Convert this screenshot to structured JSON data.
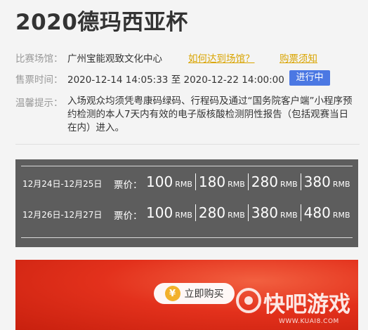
{
  "event": {
    "title": "2020德玛西亚杯"
  },
  "venue": {
    "label": "比赛场馆：",
    "name": "广州宝能观致文化中心",
    "directions_link": "如何达到场馆？",
    "ticket_notice_link": "购票须知"
  },
  "sale": {
    "label": "售票时间：",
    "start": "2020-12-14 14:05:33",
    "to": "至",
    "end": "2020-12-22 14:00:00",
    "status": "进行中"
  },
  "notice": {
    "label": "温馨提示：",
    "text": "入场观众均须凭粤康码绿码、行程码及通过“国务院客户端”小程序预约检测的本人7天内有效的电子版核酸检测阴性报告（包括观赛当日在内）进入。"
  },
  "prices": {
    "price_label": "票价：",
    "unit": "RMB",
    "rows": [
      {
        "dates": "12月24日-12月25日",
        "prices": [
          "100",
          "180",
          "280",
          "380"
        ]
      },
      {
        "dates": "12月26日-12月27日",
        "prices": [
          "100",
          "280",
          "380",
          "480"
        ]
      }
    ]
  },
  "buy": {
    "label": "立即购买",
    "icon": "¥"
  },
  "watermark": {
    "brand": "快吧游戏",
    "url": "WWW.KUAI8.COM"
  }
}
